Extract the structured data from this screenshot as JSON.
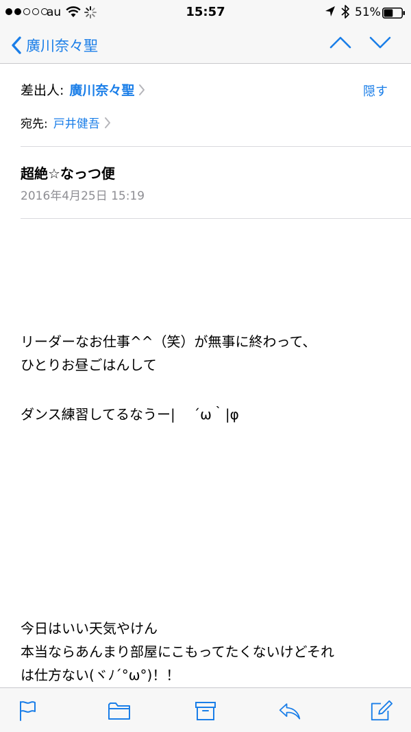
{
  "status_bar": {
    "carrier": "au",
    "time": "15:57",
    "battery_percent": "51%",
    "battery_level": 0.51,
    "signal_bars_full": 2,
    "signal_bars_total": 5
  },
  "nav": {
    "back_label": "廣川奈々聖",
    "icons": [
      "chevron-left-icon",
      "chevron-up-icon",
      "chevron-down-icon"
    ]
  },
  "header": {
    "from_label": "差出人:",
    "from_name": "廣川奈々聖",
    "hide_label": "隠す",
    "to_label": "宛先:",
    "to_name": "戸井健吾",
    "subject": "超絶☆なっつ便",
    "date": "2016年4月25日 15:19"
  },
  "body": {
    "lines": [
      "リーダーなお仕事^^（笑）が無事に終わって、",
      "ひとりお昼ごはんして",
      "ダンス練習してるなうー|　 ´ω｀|φ",
      "今日はいい天気やけん",
      "本当ならあんまり部屋にこもってたくないけどそれ",
      "は仕方ない(ヾﾉ´°ω°)！！"
    ]
  },
  "toolbar": {
    "icons": [
      "flag-icon",
      "folder-icon",
      "archive-icon",
      "reply-icon",
      "compose-icon"
    ]
  },
  "colors": {
    "accent": "#1a7ee8",
    "secondary_text": "#8e8e93",
    "bar_background": "#f7f7f7"
  }
}
